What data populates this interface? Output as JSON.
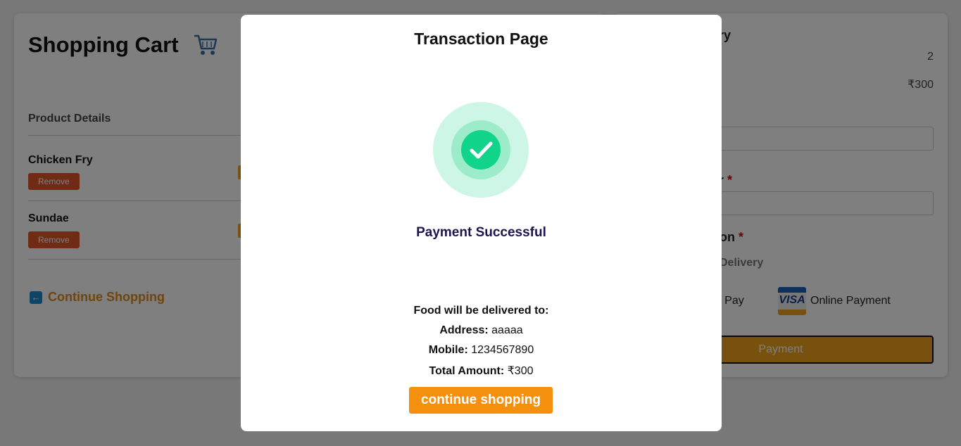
{
  "cart": {
    "title": "Shopping Cart",
    "section_label": "Product Details",
    "items": [
      {
        "name": "Chicken Fry",
        "remove_label": "Remove"
      },
      {
        "name": "Sundae",
        "remove_label": "Remove"
      }
    ],
    "continue_label": "Continue Shopping"
  },
  "summary": {
    "title_partial": "nary",
    "item_count": "2",
    "total": "₹300",
    "phone_label_partial": "ber",
    "payment_option_label_partial": "otion",
    "required_mark": "*",
    "cod_partial": "Delivery",
    "pay_on_delivery_partial": "and Pay",
    "online_payment_label": "Online Payment",
    "visa_text": "VISA",
    "payment_button": "Payment"
  },
  "modal": {
    "title": "Transaction Page",
    "status": "Payment Successful",
    "delivered_to_label": "Food will be delivered to:",
    "address_label": "Address:",
    "address_value": "aaaaa",
    "mobile_label": "Mobile:",
    "mobile_value": "1234567890",
    "total_label": "Total Amount:",
    "total_value": "₹300",
    "continue_button": "continue shopping"
  },
  "colors": {
    "accent_orange": "#f5900e",
    "success_green": "#12d38a",
    "remove_red": "#e0562a",
    "status_text": "#1d1450"
  }
}
